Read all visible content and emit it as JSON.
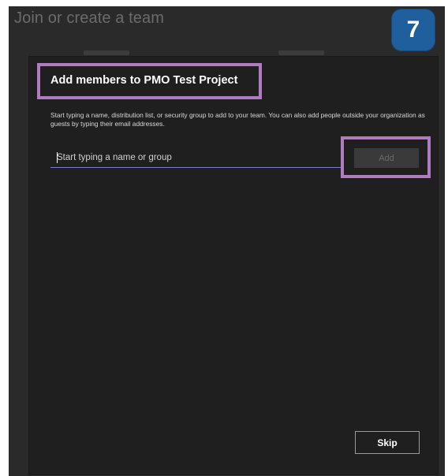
{
  "background": {
    "title": "Join or create a team"
  },
  "dialog": {
    "title": "Add members to PMO Test Project",
    "description": "Start typing a name, distribution list, or security group to add to your team. You can also add people outside your organization as guests by typing their email addresses.",
    "search": {
      "placeholder": "Start typing a name or group",
      "value": ""
    },
    "add_label": "Add",
    "skip_label": "Skip"
  },
  "step_badge": {
    "number": "7"
  },
  "colors": {
    "backdrop": "#2a2a2a",
    "dialog": "#1f1f1f",
    "highlight": "#b07cc0",
    "input_underline": "#7d7fd0",
    "badge": "#1f5f9e"
  }
}
